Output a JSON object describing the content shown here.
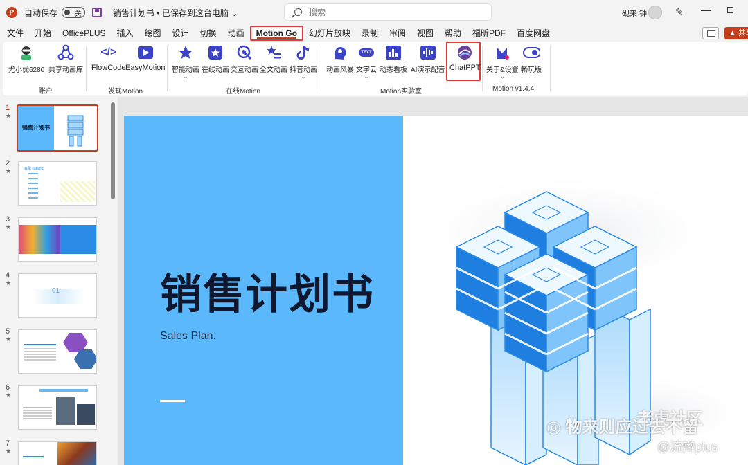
{
  "titlebar": {
    "app_icon_letter": "P",
    "autosave_label": "自动保存",
    "autosave_state": "关",
    "doc_title": "销售计划书 • 已保存到这台电脑 ⌄",
    "search_placeholder": "搜索",
    "user_name": "砚来 钟",
    "minimize": "—"
  },
  "menu": {
    "tabs": [
      "文件",
      "开始",
      "OfficePLUS",
      "插入",
      "绘图",
      "设计",
      "切换",
      "动画",
      "Motion Go",
      "幻灯片放映",
      "录制",
      "审阅",
      "视图",
      "帮助",
      "福昕PDF",
      "百度网盘"
    ],
    "active_tab": "Motion Go",
    "share_label": "共享"
  },
  "ribbon": {
    "groups": [
      {
        "label": "账户",
        "buttons": [
          "尤小优6280",
          "共享动画库"
        ]
      },
      {
        "label": "发现Motion",
        "buttons": [
          "FlowCode",
          "EasyMotion"
        ]
      },
      {
        "label": "在线Motion",
        "buttons": [
          "智能动画",
          "在线动画",
          "交互动画",
          "全文动画",
          "抖音动画"
        ]
      },
      {
        "label": "Motion实验室",
        "buttons": [
          "动画风暴",
          "文字云",
          "动态看板",
          "AI演示配音",
          "ChatPPT"
        ]
      },
      {
        "label": "Motion v1.4.4",
        "buttons": [
          "关于&设置",
          "畅玩版"
        ]
      }
    ],
    "icon_texts": {
      "flowcode": "</>",
      "wordcloud": "TEXT"
    },
    "colors": {
      "accent": "#3b44c8",
      "highlight": "#e53935",
      "brand": "#c43e1c"
    }
  },
  "thumbnails": {
    "numbers": [
      "1",
      "2",
      "3",
      "4",
      "5",
      "6",
      "7"
    ],
    "selected": "1",
    "star": "★",
    "slide2_title": "目录 catalog",
    "slide4_num": "01"
  },
  "slide": {
    "title": "销售计划书",
    "subtitle": "Sales Plan.",
    "watermark_wechat": "物来则应过去不留",
    "watermark_site": "老虎社区",
    "watermark_author": "@流辫plus"
  }
}
